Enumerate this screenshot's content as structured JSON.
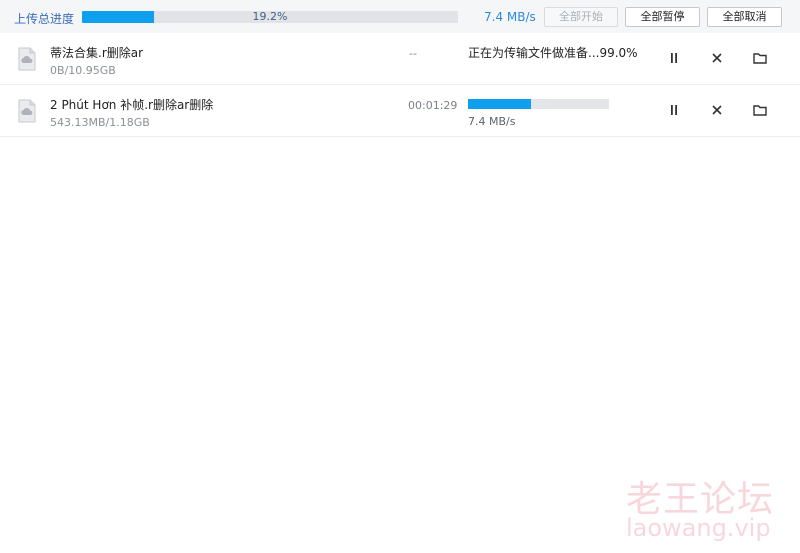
{
  "header": {
    "label": "上传总进度",
    "progress_percent": 19.2,
    "progress_text": "19.2%",
    "speed": "7.4 MB/s",
    "buttons": {
      "start_all": "全部开始",
      "pause_all": "全部暂停",
      "cancel_all": "全部取消"
    }
  },
  "uploads": [
    {
      "name": "蒂法合集.r删除ar",
      "size": "0B/10.95GB",
      "time": "--",
      "status": "正在为传输文件做准备...99.0%",
      "icons": [
        "file-cloud-icon",
        "pause-icon",
        "close-icon",
        "folder-icon"
      ]
    },
    {
      "name": "2 Phút Hơn 补帧.r删除ar删除",
      "size": "543.13MB/1.18GB",
      "time": "00:01:29",
      "progress_percent": 45,
      "speed": "7.4 MB/s",
      "icons": [
        "file-cloud-icon",
        "pause-icon",
        "close-icon",
        "folder-icon"
      ]
    }
  ],
  "watermark": {
    "title": "老王论坛",
    "url": "laowang.vip"
  },
  "colors": {
    "accent": "#0ea0ee",
    "label_blue": "#3a6fb5",
    "speed_blue": "#2d8ad8",
    "watermark": "#e66e82"
  }
}
